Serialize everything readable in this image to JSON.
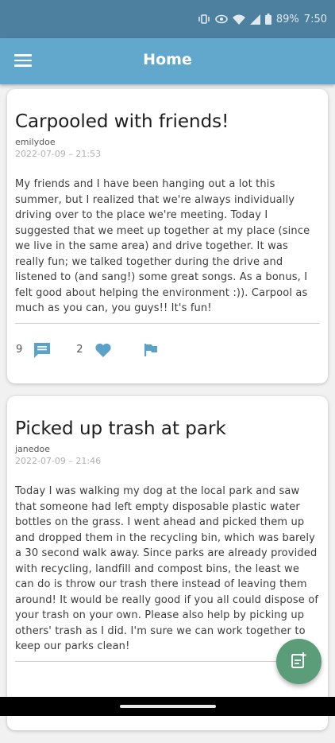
{
  "status_bar": {
    "battery": "89%",
    "time": "7:50",
    "icons": [
      "vibrate-icon",
      "eye-icon",
      "wifi-icon",
      "signal-icon",
      "battery-icon"
    ]
  },
  "app_bar": {
    "title": "Home",
    "menu_icon": "menu-icon"
  },
  "posts": [
    {
      "title": "Carpooled with friends!",
      "author": "emilydoe",
      "timestamp": "2022-07-09 – 21:53",
      "body": "My friends and I have been hanging out a lot this summer, but I realized that we're always individually driving over to the place we're meeting. Today I suggested that we meet up together at my place (since we live in the same area) and drive together. It was really fun; we talked together during the drive and listened to (and sang!) some great songs. As a bonus, I felt good about helping the environment :)). Carpool as much as you can, you guys!! It's fun!",
      "comment_count": "9",
      "like_count": "2"
    },
    {
      "title": "Picked up trash at park",
      "author": "janedoe",
      "timestamp": "2022-07-09 – 21:46",
      "body": "Today I was walking my dog at the local park and saw that someone had left empty disposable plastic water bottles on the grass. I went ahead and picked them up and dropped them in the recycling bin, which was barely a 30 second walk away. Since parks are already provided with recycling, landfill and compost bins, the least we can do is throw our trash there instead of leaving them around! It would be really good if you all could dispose of your trash on your own. Please also help by picking up others' trash as I did. I'm sure we can work together to keep our parks clean!"
    }
  ],
  "colors": {
    "status_bar": "#4d7f9f",
    "app_bar": "#62a7cc",
    "action_icons": "#5aa2c8",
    "fab": "#5a9d78"
  },
  "fab_icon": "new-post-icon"
}
